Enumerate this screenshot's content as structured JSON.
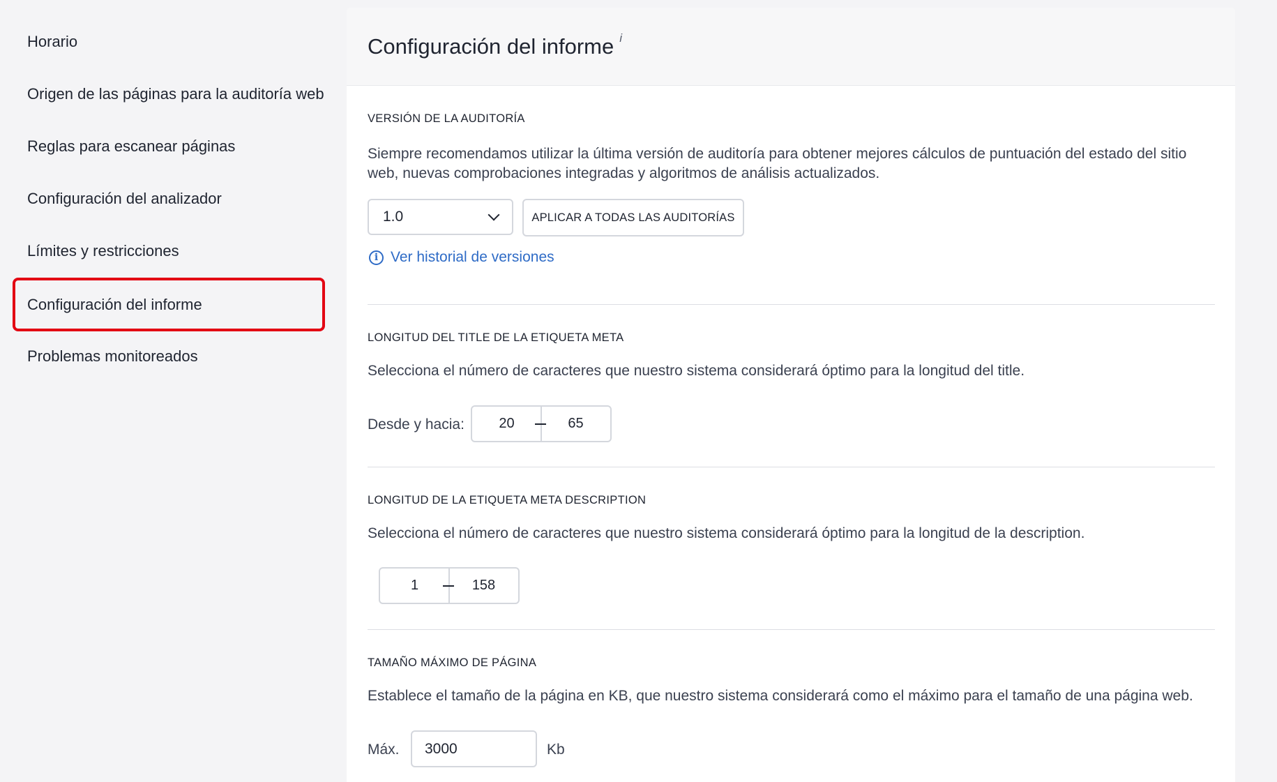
{
  "sidebar": {
    "items": [
      {
        "label": "Horario",
        "active": false
      },
      {
        "label": "Origen de las páginas para la auditoría web",
        "active": false
      },
      {
        "label": "Reglas para escanear páginas",
        "active": false
      },
      {
        "label": "Configuración del analizador",
        "active": false
      },
      {
        "label": "Límites y restricciones",
        "active": false
      },
      {
        "label": "Configuración del informe",
        "active": true
      },
      {
        "label": "Problemas monitoreados",
        "active": false
      }
    ],
    "highlight_color": "#e30613"
  },
  "panel": {
    "title": "Configuración del informe",
    "info_marker": "i"
  },
  "audit_version": {
    "label": "VERSIÓN DE LA AUDITORÍA",
    "description": "Siempre recomendamos utilizar la última versión de auditoría para obtener mejores cálculos de puntuación del estado del sitio web, nuevas comprobaciones integradas y algoritmos de análisis actualizados.",
    "selected_version": "1.0",
    "apply_button": "APLICAR A TODAS LAS AUDITORÍAS",
    "history_link": "Ver historial de versiones",
    "link_color": "#2e6bc6"
  },
  "title_length": {
    "label": "LONGITUD DEL TITLE DE LA ETIQUETA META",
    "description": "Selecciona el número de caracteres que nuestro sistema considerará óptimo para la longitud del title.",
    "range_label": "Desde y hacia:",
    "from": "20",
    "to": "65"
  },
  "description_length": {
    "label": "LONGITUD DE LA ETIQUETA META DESCRIPTION",
    "description": "Selecciona el número de caracteres que nuestro sistema considerará óptimo para la longitud de la description.",
    "from": "1",
    "to": "158"
  },
  "max_page_size": {
    "label": "TAMAÑO MÁXIMO DE PÁGINA",
    "description": "Establece el tamaño de la página en KB, que nuestro sistema considerará como el máximo para el tamaño de una página web.",
    "max_label": "Máx.",
    "value": "3000",
    "unit": "Kb"
  }
}
